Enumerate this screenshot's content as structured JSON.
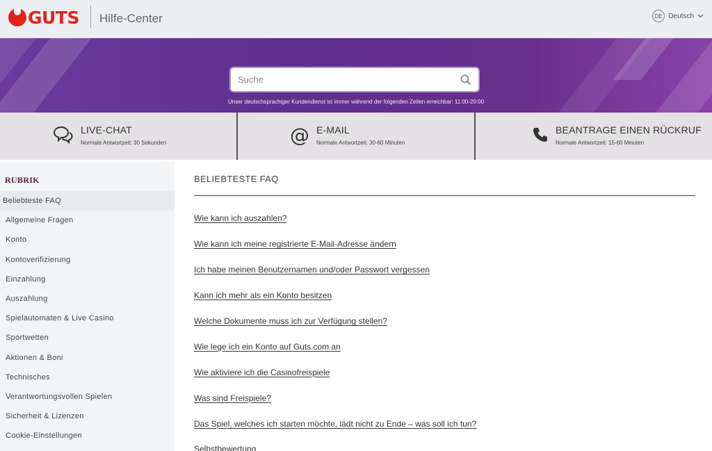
{
  "header": {
    "brand": "GUTS",
    "title": "Hilfe-Center",
    "language": {
      "badge": "DE",
      "label": "Deutsch"
    }
  },
  "hero": {
    "search_placeholder": "Suche",
    "hours_text": "Unser deutschsprachiger Kundendienst ist immer während der folgenden Zeiten erreichbar: 11:00-20:00"
  },
  "contacts": [
    {
      "icon": "chat-bubbles-icon",
      "title": "LIVE-CHAT",
      "subtitle": "Normale Antwortzeit: 30 Sekunden"
    },
    {
      "icon": "at-sign-icon",
      "title": "E-MAIL",
      "subtitle": "Normale Antwortzeit: 30-60 Minuten"
    },
    {
      "icon": "phone-icon",
      "title": "BEANTRAGE EINEN RÜCKRUF",
      "subtitle": "Normale Antwortzeit: 15-60 Minuten"
    }
  ],
  "sidebar": {
    "heading": "RUBRIK",
    "items": [
      {
        "label": "Beliebteste FAQ"
      },
      {
        "label": "Allgemeine Fragen"
      },
      {
        "label": "Konto"
      },
      {
        "label": "Kontoverifizierung"
      },
      {
        "label": "Einzahlung"
      },
      {
        "label": "Auszahlung"
      },
      {
        "label": "Spielautomaten & Live Casino"
      },
      {
        "label": "Sportwetten"
      },
      {
        "label": "Aktionen & Boni"
      },
      {
        "label": "Technisches"
      },
      {
        "label": "Verantwortungsvollen Spielen"
      },
      {
        "label": "Sicherheit & Lizenzen"
      },
      {
        "label": "Cookie-Einstellungen"
      }
    ]
  },
  "main": {
    "title": "BELIEBTESTE FAQ",
    "faqs": [
      {
        "label": "Wie kann ich auszahlen?"
      },
      {
        "label": "Wie kann ich meine registrierte E-Mail-Adresse ändern"
      },
      {
        "label": "Ich habe meinen Benutzernamen und/oder Passwort vergessen"
      },
      {
        "label": "Kann ich mehr als ein Konto besitzen"
      },
      {
        "label": "Welche Dokumente muss ich zur Verfügung stellen?"
      },
      {
        "label": "Wie lege ich ein Konto auf Guts.com an"
      },
      {
        "label": "Wie aktiviere ich die Casinofreispiele"
      },
      {
        "label": "Was sind Freispiele?"
      },
      {
        "label": "Das Spiel, welches ich starten möchte, lädt nicht zu Ende – was soll ich tun?"
      },
      {
        "label": "Selbstbewertung"
      }
    ]
  },
  "colors": {
    "brand_red": "#e2231a",
    "hero_purple": "#6a3a9c",
    "rubrik_color": "#5a1a4a"
  }
}
